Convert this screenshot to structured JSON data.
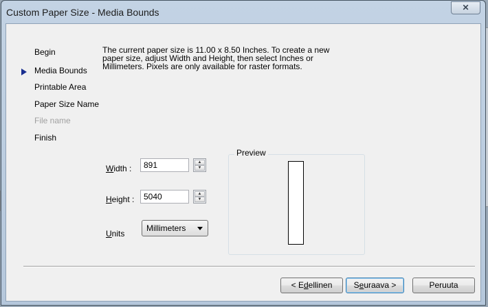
{
  "window": {
    "title": "Custom Paper Size - Media Bounds",
    "close_glyph": "✕"
  },
  "sidebar": {
    "items": [
      {
        "label": "Begin",
        "state": "normal"
      },
      {
        "label": "Media Bounds",
        "state": "current"
      },
      {
        "label": "Printable Area",
        "state": "normal"
      },
      {
        "label": "Paper Size Name",
        "state": "normal"
      },
      {
        "label": "File name",
        "state": "disabled"
      },
      {
        "label": "Finish",
        "state": "normal"
      }
    ],
    "current_marker_icon": "triangle-right-icon"
  },
  "description": {
    "lines": [
      "The current paper size is 11.00 x 8.50 Inches. To create a new",
      "paper size, adjust Width and Height, then select Inches or",
      "Millimeters. Pixels are only available for raster formats."
    ]
  },
  "fields": {
    "width": {
      "label_mnemonic": "W",
      "label_rest": "idth :",
      "value": "891"
    },
    "height": {
      "label_mnemonic": "H",
      "label_rest": "eight :",
      "value": "5040"
    },
    "units": {
      "label_mnemonic": "U",
      "label_rest": "nits",
      "selected": "Millimeters"
    }
  },
  "preview": {
    "label": "Preview"
  },
  "buttons": {
    "back": {
      "prefix": "< ",
      "mnemonic_before": "E",
      "mnemonic": "d",
      "rest": "ellinen"
    },
    "next": {
      "before": "S",
      "mnemonic": "e",
      "rest": "uraava >"
    },
    "cancel": {
      "label": "Peruuta"
    }
  },
  "colors": {
    "window_frame": "#c3d3e4",
    "client_bg": "#f0f0f0",
    "current_marker": "#1a2f90",
    "disabled_text": "#a0a0a0"
  }
}
